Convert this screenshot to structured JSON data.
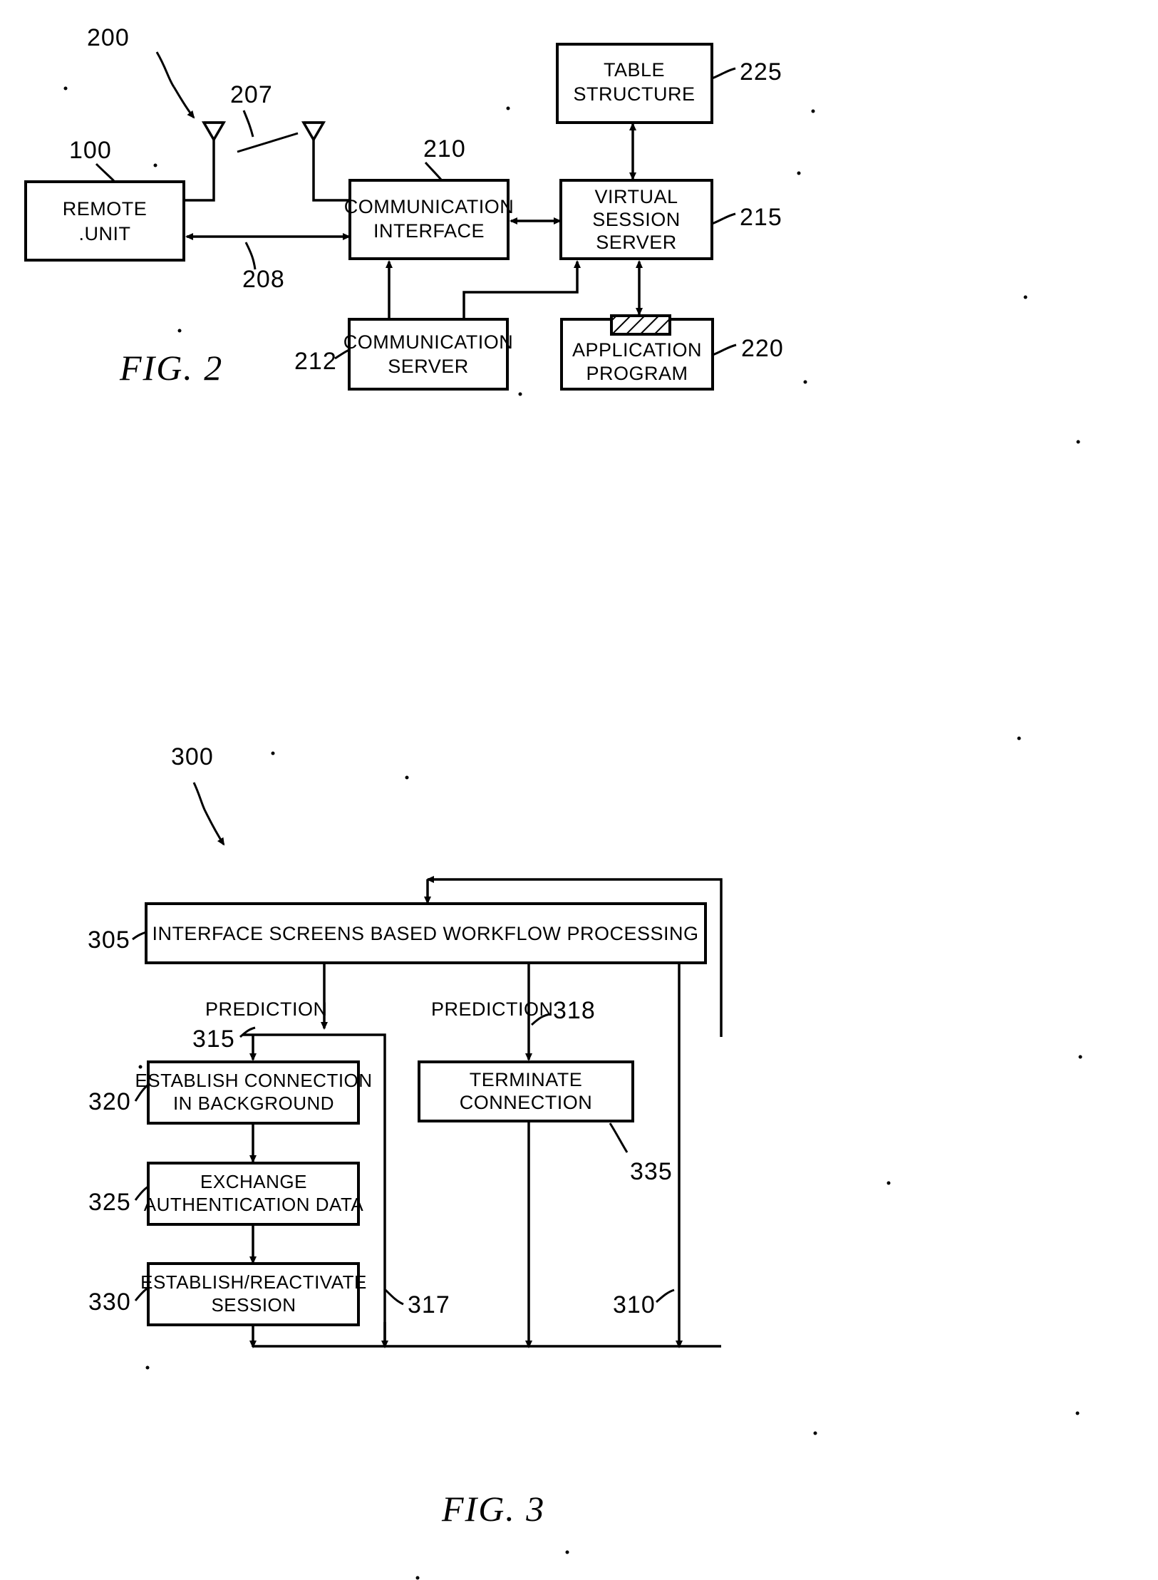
{
  "figures": [
    {
      "id": "fig2",
      "caption": "FIG.  2",
      "system_ref": "200",
      "nodes": {
        "remote_unit": {
          "label_line1": "REMOTE",
          "label_line2": ".UNIT",
          "ref": "100"
        },
        "communication_interface": {
          "label_line1": "COMMUNICATION",
          "label_line2": "INTERFACE",
          "ref": "210"
        },
        "communication_server": {
          "label_line1": "COMMUNICATION",
          "label_line2": "SERVER",
          "ref": "212"
        },
        "virtual_session_server": {
          "label_line1": "VIRTUAL",
          "label_line2": "SESSION",
          "label_line3": "SERVER",
          "ref": "215"
        },
        "table_structure": {
          "label_line1": "TABLE",
          "label_line2": "STRUCTURE",
          "ref": "225"
        },
        "application_program": {
          "label_line1": "APPLICATION",
          "label_line2": "PROGRAM",
          "ref": "220"
        }
      },
      "link_refs": {
        "wireless_link": "207",
        "remote_link": "208"
      }
    },
    {
      "id": "fig3",
      "caption": "FIG.  3",
      "system_ref": "300",
      "nodes": {
        "workflow_processing": {
          "label_line1": "INTERFACE  SCREENS  BASED  WORKFLOW  PROCESSING",
          "ref": "305"
        },
        "establish_connection": {
          "label_line1": "ESTABLISH  CONNECTION",
          "label_line2": "IN  BACKGROUND",
          "ref": "320"
        },
        "exchange_auth": {
          "label_line1": "EXCHANGE",
          "label_line2": "AUTHENTICATION  DATA",
          "ref": "325"
        },
        "establish_session": {
          "label_line1": "ESTABLISH/REACTIVATE",
          "label_line2": "SESSION",
          "ref": "330"
        },
        "terminate_connection": {
          "label_line1": "TERMINATE",
          "label_line2": "CONNECTION",
          "ref": "335"
        }
      },
      "edge_labels": {
        "prediction_left": "PREDICTION",
        "prediction_right": "PREDICTION"
      },
      "flow_refs": {
        "left_branch": "315",
        "right_branch": "318",
        "return_mid": "317",
        "return_outer": "310"
      }
    }
  ]
}
